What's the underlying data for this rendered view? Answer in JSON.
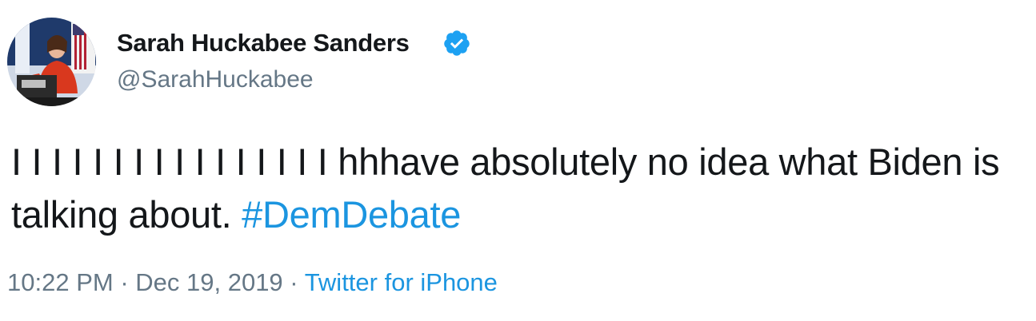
{
  "author": {
    "display_name": "Sarah Huckabee Sanders",
    "handle": "@SarahHuckabee",
    "verified_icon": "verified-badge-icon",
    "avatar_icon": "profile-photo"
  },
  "tweet": {
    "text": "I I I I I I I I I I I I I I I I hhhave absolutely no idea what Biden is talking about. ",
    "hashtag": "#DemDebate"
  },
  "meta": {
    "time": "10:22 PM",
    "separator_1": " · ",
    "date": "Dec 19, 2019",
    "separator_2": " · ",
    "source": "Twitter for iPhone"
  },
  "colors": {
    "text": "#14171a",
    "secondary": "#657786",
    "link": "#1b95e0",
    "verified": "#1da1f2"
  }
}
